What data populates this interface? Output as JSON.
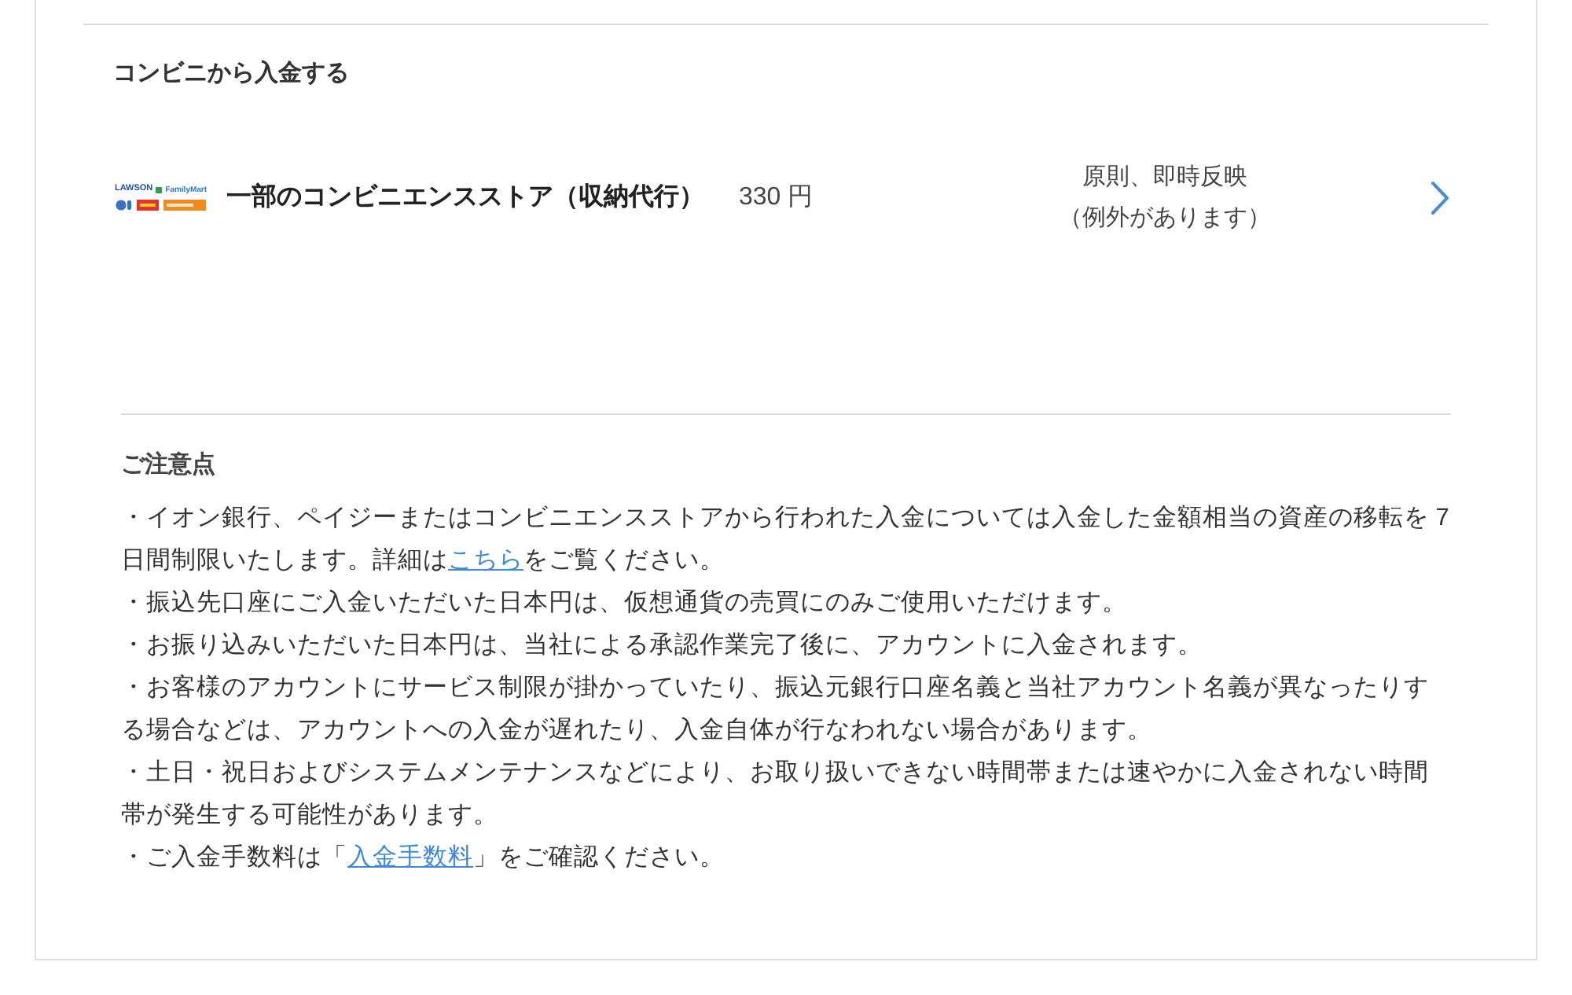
{
  "deposit_section": {
    "title": "コンビニから入金する",
    "methods": [
      {
        "logo": {
          "texts": [
            "LAWSON",
            "FamilyMart"
          ]
        },
        "name": "一部のコンビニエンスストア（収納代行）",
        "fee": "330 円",
        "reflection": [
          "原則、即時反映",
          "（例外があります）"
        ]
      }
    ]
  },
  "notes": {
    "title": "ご注意点",
    "items": [
      {
        "segments": [
          {
            "kind": "text",
            "text": "・イオン銀行、ペイジーまたはコンビニエンスストアから行われた入金については入金した金額相当の資産の移転を 7 日間制限いたします。詳細は"
          },
          {
            "kind": "link",
            "text": "こちら"
          },
          {
            "kind": "text",
            "text": "をご覧ください。"
          }
        ]
      },
      {
        "segments": [
          {
            "kind": "text",
            "text": "・振込先口座にご入金いただいた日本円は、仮想通貨の売買にのみご使用いただけます。"
          }
        ]
      },
      {
        "segments": [
          {
            "kind": "text",
            "text": "・お振り込みいただいた日本円は、当社による承認作業完了後に、アカウントに入金されます。"
          }
        ]
      },
      {
        "segments": [
          {
            "kind": "text",
            "text": "・お客様のアカウントにサービス制限が掛かっていたり、振込元銀行口座名義と当社アカウント名義が異なったりする場合などは、アカウントへの入金が遅れたり、入金自体が行なわれない場合があります。"
          }
        ]
      },
      {
        "segments": [
          {
            "kind": "text",
            "text": "・土日・祝日およびシステムメンテナンスなどにより、お取り扱いできない時間帯または速やかに入金されない時間帯が発生する可能性があります。"
          }
        ]
      },
      {
        "segments": [
          {
            "kind": "text",
            "text": "・ご入金手数料は「"
          },
          {
            "kind": "link",
            "text": "入金手数料"
          },
          {
            "kind": "text",
            "text": "」をご確認ください。"
          }
        ]
      }
    ]
  }
}
